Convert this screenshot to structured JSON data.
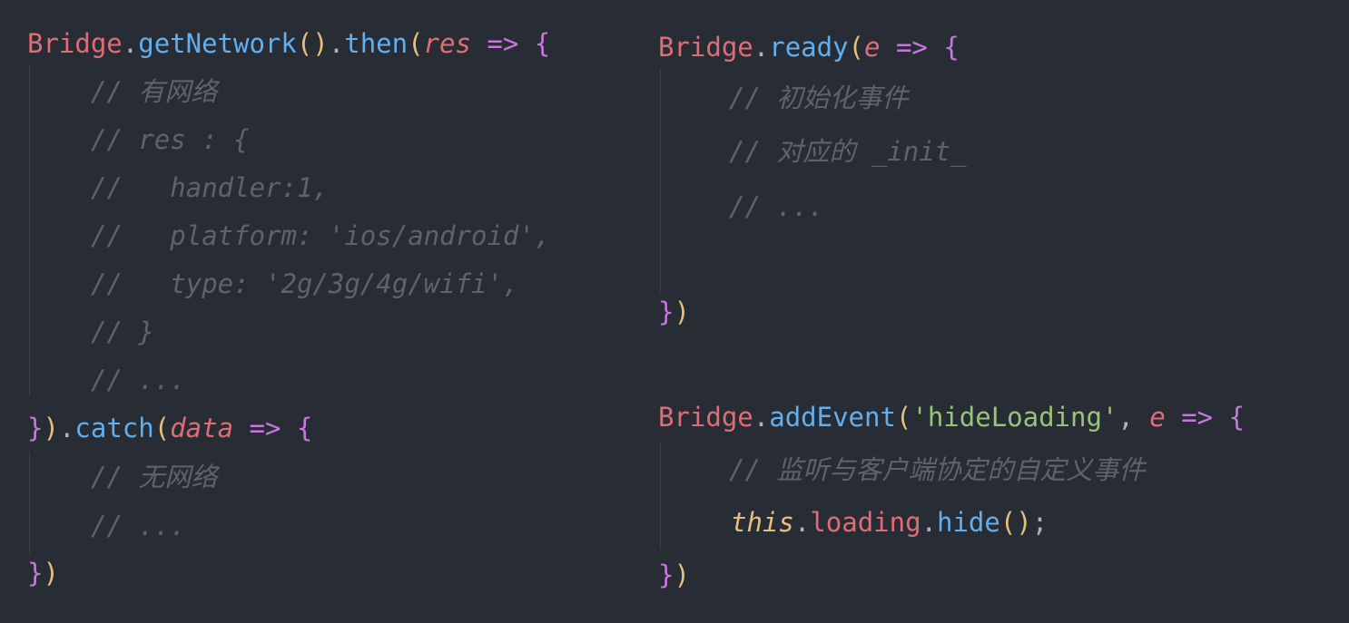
{
  "left_code": {
    "l1": {
      "obj": "Bridge",
      "dot": ".",
      "fn1": "getNetwork",
      "p1": "()",
      "dot2": ".",
      "fn2": "then",
      "p2": "(",
      "param": "res",
      "arrow": " => ",
      "brace": "{"
    },
    "comments": [
      "// 有网络",
      "// res : {",
      "//   handler:1,",
      "//   platform: 'ios/android',",
      "//   type: '2g/3g/4g/wifi',",
      "// }",
      "// ..."
    ],
    "l9": {
      "brace": "}",
      "paren": ")",
      "dot": ".",
      "fn": "catch",
      "p": "(",
      "param": "data",
      "arrow": " => ",
      "brace2": "{"
    },
    "comments2": [
      "// 无网络",
      "// ..."
    ],
    "l12": {
      "brace": "}",
      "paren": ")"
    }
  },
  "right_code": {
    "l1": {
      "obj": "Bridge",
      "dot": ".",
      "fn": "ready",
      "p": "(",
      "param": "e",
      "arrow": " => ",
      "brace": "{"
    },
    "comments": [
      "// 初始化事件",
      "// 对应的 _init_",
      "// ..."
    ],
    "l_close": {
      "brace": "}",
      "paren": ")"
    },
    "l2": {
      "obj": "Bridge",
      "dot": ".",
      "fn": "addEvent",
      "p": "(",
      "str": "'hideLoading'",
      "comma": ", ",
      "param": "e",
      "arrow": " => ",
      "brace": "{"
    },
    "comment2": "// 监听与客户端协定的自定义事件",
    "l3": {
      "this": "this",
      "dot": ".",
      "prop": "loading",
      "dot2": ".",
      "fn": "hide",
      "p": "()",
      "semi": ";"
    },
    "l_close2": {
      "brace": "}",
      "paren": ")"
    }
  },
  "colors": {
    "background": "#282c34",
    "object": "#e06c75",
    "function": "#61afef",
    "string": "#98c379",
    "keyword_brace": "#c678dd",
    "paren": "#e5c07b",
    "comment": "#5c6370"
  }
}
